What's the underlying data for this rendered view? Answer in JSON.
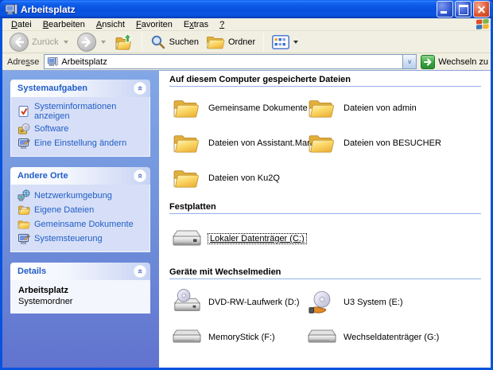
{
  "window": {
    "title": "Arbeitsplatz",
    "controls": {
      "minimize": "minimize",
      "maximize": "maximize",
      "close": "close"
    }
  },
  "colors": {
    "titlebar_blue": "#0854e0",
    "toolbar_beige": "#f1efe2",
    "sidebar_blue_top": "#82a7e6",
    "sidebar_blue_bottom": "#6173ce",
    "panel_body": "#d6dff7",
    "link_blue": "#215dc6",
    "group_rule": "#93b2e8",
    "go_green": "#3aa33f",
    "close_red": "#dd5731"
  },
  "icons": {
    "window-icon": "my-computer",
    "minimize-icon": "underscore-bar",
    "maximize-icon": "square-outline",
    "close-icon": "x-cross",
    "back-icon": "white-left-arrow-in-gray-circle",
    "forward-icon": "white-right-arrow-in-gray-circle",
    "up-icon": "folder-with-green-up-arrow",
    "search-icon": "magnifier",
    "folders-icon": "open-folder",
    "views-icon": "blue-grid",
    "dropdown-icon": "small-caret-down",
    "go-icon": "white-right-arrow-in-green-square",
    "windows-logo-icon": "four-color-flag",
    "collapse-chevron-icon": "double-chevron-up-in-circle",
    "folder-icon": "yellow-folder",
    "hard-drive-icon": "gray-hard-disk",
    "dvd-drive-icon": "hard-disk-with-disc",
    "u3-cd-icon": "disc-with-orange-hand",
    "removable-drive-icon": "flat-gray-removable-disk"
  },
  "menubar": {
    "items": [
      {
        "label": "Datei",
        "pre": "",
        "accel": "D",
        "post": "atei"
      },
      {
        "label": "Bearbeiten",
        "pre": "",
        "accel": "B",
        "post": "earbeiten"
      },
      {
        "label": "Ansicht",
        "pre": "",
        "accel": "A",
        "post": "nsicht"
      },
      {
        "label": "Favoriten",
        "pre": "",
        "accel": "F",
        "post": "avoriten"
      },
      {
        "label": "Extras",
        "pre": "E",
        "accel": "x",
        "post": "tras"
      },
      {
        "label": "?",
        "pre": "",
        "accel": "?",
        "post": ""
      }
    ]
  },
  "toolbar": {
    "back_label": "Zurück",
    "search_label": "Suchen",
    "folders_label": "Ordner"
  },
  "addressbar": {
    "label_pre": "Adre",
    "label_accel": "s",
    "label_post": "se",
    "value": "Arbeitsplatz",
    "go_label": "Wechseln zu",
    "dropdown_glyph": "˅"
  },
  "sidebar": {
    "panels": [
      {
        "title": "Systemaufgaben",
        "items": [
          {
            "label": "Systeminformationen anzeigen",
            "icon": "system-info-icon"
          },
          {
            "label": "Software",
            "icon": "software-icon"
          },
          {
            "label": "Eine Einstellung ändern",
            "icon": "control-panel-icon"
          }
        ]
      },
      {
        "title": "Andere Orte",
        "items": [
          {
            "label": "Netzwerkumgebung",
            "icon": "network-places-icon"
          },
          {
            "label": "Eigene Dateien",
            "icon": "my-documents-icon"
          },
          {
            "label": "Gemeinsame Dokumente",
            "icon": "shared-documents-icon"
          },
          {
            "label": "Systemsteuerung",
            "icon": "control-panel-icon"
          }
        ]
      },
      {
        "title": "Details",
        "details": {
          "name": "Arbeitsplatz",
          "type": "Systemordner"
        }
      }
    ]
  },
  "main": {
    "groups": [
      {
        "title": "Auf diesem Computer gespeicherte Dateien",
        "items": [
          {
            "label": "Gemeinsame Dokumente",
            "icon": "folder-icon"
          },
          {
            "label": "Dateien von admin",
            "icon": "folder-icon"
          },
          {
            "label": "Dateien von Assistant.Marketing",
            "icon": "folder-icon"
          },
          {
            "label": "Dateien von BESUCHER",
            "icon": "folder-icon"
          },
          {
            "label": "Dateien von Ku2Q",
            "icon": "folder-icon"
          }
        ]
      },
      {
        "title": "Festplatten",
        "items": [
          {
            "label": "Lokaler Datenträger (C:)",
            "icon": "hard-drive-icon",
            "selected": true
          }
        ]
      },
      {
        "title": "Geräte mit Wechselmedien",
        "items": [
          {
            "label": "DVD-RW-Laufwerk (D:)",
            "icon": "dvd-drive-icon"
          },
          {
            "label": "U3 System (E:)",
            "icon": "u3-cd-icon"
          },
          {
            "label": "MemoryStick (F:)",
            "icon": "removable-drive-icon"
          },
          {
            "label": "Wechseldatenträger (G:)",
            "icon": "removable-drive-icon"
          }
        ]
      }
    ]
  }
}
